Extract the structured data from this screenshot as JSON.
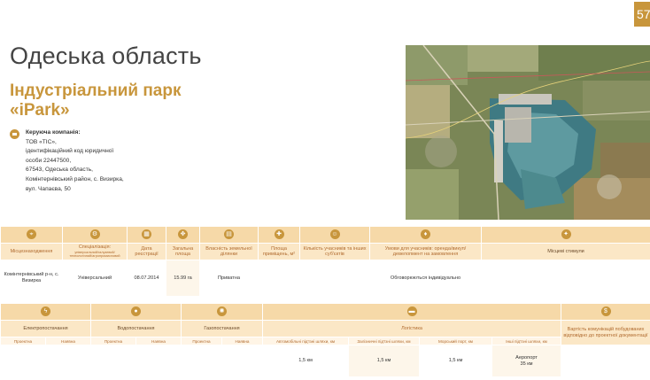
{
  "page_number": "57",
  "region_title": "Одеська область",
  "park_title": {
    "line1": "Індустріальний парк",
    "line2": "«iPark»"
  },
  "company": {
    "label": "Керуюча компанія:",
    "lines": [
      "ТОВ «ТІС»,",
      "ідентифікаційний код юридичної",
      "особи 22447500,",
      "67543, Одеська область,",
      "Комінтернівський район, с. Визирка,",
      "вул. Чапаєва, 50"
    ],
    "icon": "building-icon"
  },
  "table1": {
    "headers": [
      {
        "label": "Місцезнаходження",
        "icon": "location-icon"
      },
      {
        "label": "Спеціалізація:",
        "sub": "універсальний/галузевий/технологічний/агропромисловий",
        "icon": "gear-icon"
      },
      {
        "label": "Дата реєстрації",
        "icon": "calendar-icon"
      },
      {
        "label": "Загальна площа",
        "icon": "area-icon"
      },
      {
        "label": "Власність земельної ділянки",
        "icon": "document-icon"
      },
      {
        "label": "Площа приміщень, м²",
        "icon": "building-icon"
      },
      {
        "label": "Кількість учасників та інших суб'єктів",
        "icon": "people-icon"
      },
      {
        "label": "Умови для учасників: оренда/викуп/девелопмент на замовлення",
        "icon": "handshake-icon"
      },
      {
        "label": "Місцеві стимули",
        "icon": "incentive-icon"
      }
    ],
    "row": [
      "Комінтернівський р-н, с. Визирка",
      "Універсальний",
      "08.07.2014",
      "15.99 га",
      "Приватна",
      "",
      "",
      "Обговорюються індивідуально",
      ""
    ]
  },
  "table2": {
    "groups": [
      {
        "label": "Електропостачання",
        "icon": "electricity-icon",
        "sub": [
          "Проектна",
          "Наявна"
        ]
      },
      {
        "label": "Водопостачання",
        "icon": "water-icon",
        "sub": [
          "Проектна",
          "Наявна"
        ]
      },
      {
        "label": "Газопостачання",
        "icon": "gas-icon",
        "sub": [
          "Проектна",
          "Наявна"
        ]
      },
      {
        "label": "Логістика",
        "icon": "truck-icon",
        "sub": [
          "Автомобільні під'їзні шляхи, км",
          "Залізничні під'їзні шляхи, км",
          "Морський порт, км",
          "Інші під'їзні шляхи, км"
        ]
      },
      {
        "label": "Вартість комунікацій побудованих відповідно до проектної документації",
        "icon": "money-icon"
      }
    ],
    "row": [
      "",
      "",
      "",
      "",
      "",
      "",
      "1,5 км",
      "1,5 км",
      "1,5 км",
      "Аеропорт\n35 км",
      ""
    ]
  }
}
